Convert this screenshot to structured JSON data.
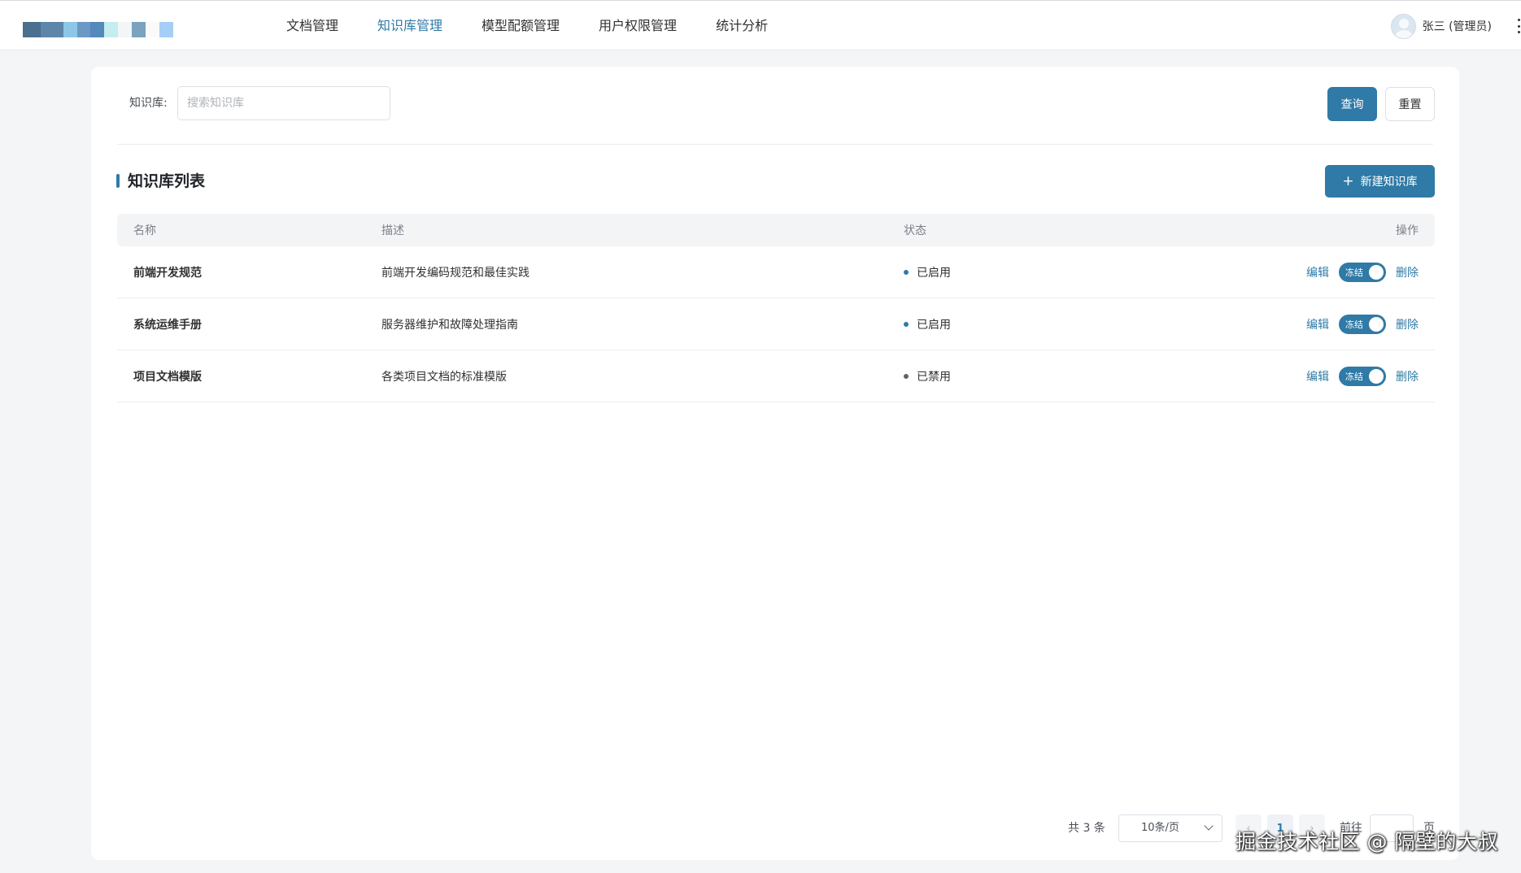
{
  "header": {
    "logo_colors": [
      "#4a6f8f",
      "#5d86a8",
      "#8ec6e6",
      "#6b98c4",
      "#5588bb",
      "#c5ecef",
      "#f3f6f6",
      "#7aa3c0",
      "#fafafa",
      "#a6cdf5"
    ],
    "nav": [
      {
        "label": "文档管理",
        "active": false
      },
      {
        "label": "知识库管理",
        "active": true
      },
      {
        "label": "模型配额管理",
        "active": false
      },
      {
        "label": "用户权限管理",
        "active": false
      },
      {
        "label": "统计分析",
        "active": false
      }
    ],
    "user_name": "张三 (管理员)"
  },
  "search": {
    "label": "知识库:",
    "placeholder": "搜索知识库",
    "value": "",
    "query_label": "查询",
    "reset_label": "重置"
  },
  "section": {
    "title": "知识库列表",
    "new_button_label": "新建知识库"
  },
  "table": {
    "columns": {
      "name": "名称",
      "desc": "描述",
      "status": "状态",
      "ops": "操作"
    },
    "rows": [
      {
        "name": "前端开发规范",
        "desc": "前端开发编码规范和最佳实践",
        "status": "已启用",
        "status_color": "#2f7aa6",
        "edit": "编辑",
        "toggle": "冻结",
        "delete": "删除"
      },
      {
        "name": "系统运维手册",
        "desc": "服务器维护和故障处理指南",
        "status": "已启用",
        "status_color": "#2f7aa6",
        "edit": "编辑",
        "toggle": "冻结",
        "delete": "删除"
      },
      {
        "name": "项目文档模版",
        "desc": "各类项目文档的标准模版",
        "status": "已禁用",
        "status_color": "#606266",
        "edit": "编辑",
        "toggle": "冻结",
        "delete": "删除"
      }
    ]
  },
  "pagination": {
    "total": "共 3 条",
    "page_size": "10条/页",
    "current_page": "1",
    "goto_label": "前往",
    "page_unit": "页"
  },
  "watermark": "掘金技术社区 @ 隔壁的大叔",
  "colors": {
    "accent": "#2f7aa6",
    "background": "#f4f5f7"
  }
}
